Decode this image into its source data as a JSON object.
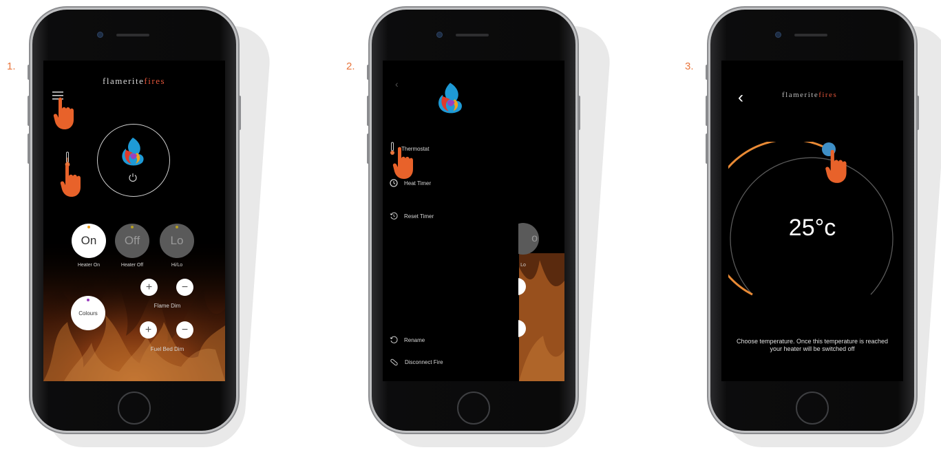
{
  "steps": [
    {
      "number": "1."
    },
    {
      "number": "2."
    },
    {
      "number": "3."
    }
  ],
  "brand": {
    "name_main": "flamerite",
    "name_accent": "fires"
  },
  "screen1": {
    "heater_buttons": [
      {
        "text": "On",
        "label": "Heater On"
      },
      {
        "text": "Off",
        "label": "Heater Off"
      },
      {
        "text": "Lo",
        "label": "Hi/Lo"
      }
    ],
    "colours_label": "Colours",
    "flame_dim_label": "Flame Dim",
    "fuel_bed_dim_label": "Fuel Bed Dim",
    "plus_symbol": "+",
    "minus_symbol": "−"
  },
  "screen2": {
    "menu_items": [
      {
        "label": "Thermostat",
        "icon": "thermometer-icon"
      },
      {
        "label": "Heat Timer",
        "icon": "timer-icon"
      },
      {
        "label": "Reset Timer",
        "icon": "reset-timer-icon"
      },
      {
        "label": "Rename",
        "icon": "rename-icon"
      },
      {
        "label": "Disconnect Fire",
        "icon": "disconnect-icon"
      }
    ],
    "peek_button_text": "o",
    "peek_label": "Lo"
  },
  "screen3": {
    "back_symbol": "‹",
    "temperature": "25°c",
    "instruction_line1": "Choose temperature. Once this temperature is reached",
    "instruction_line2": "your heater will be switched off"
  },
  "colors": {
    "accent_orange": "#e8743b",
    "dial_orange": "#e98a35",
    "knob_blue": "#3f8fc6",
    "hand": "#e8622a"
  }
}
